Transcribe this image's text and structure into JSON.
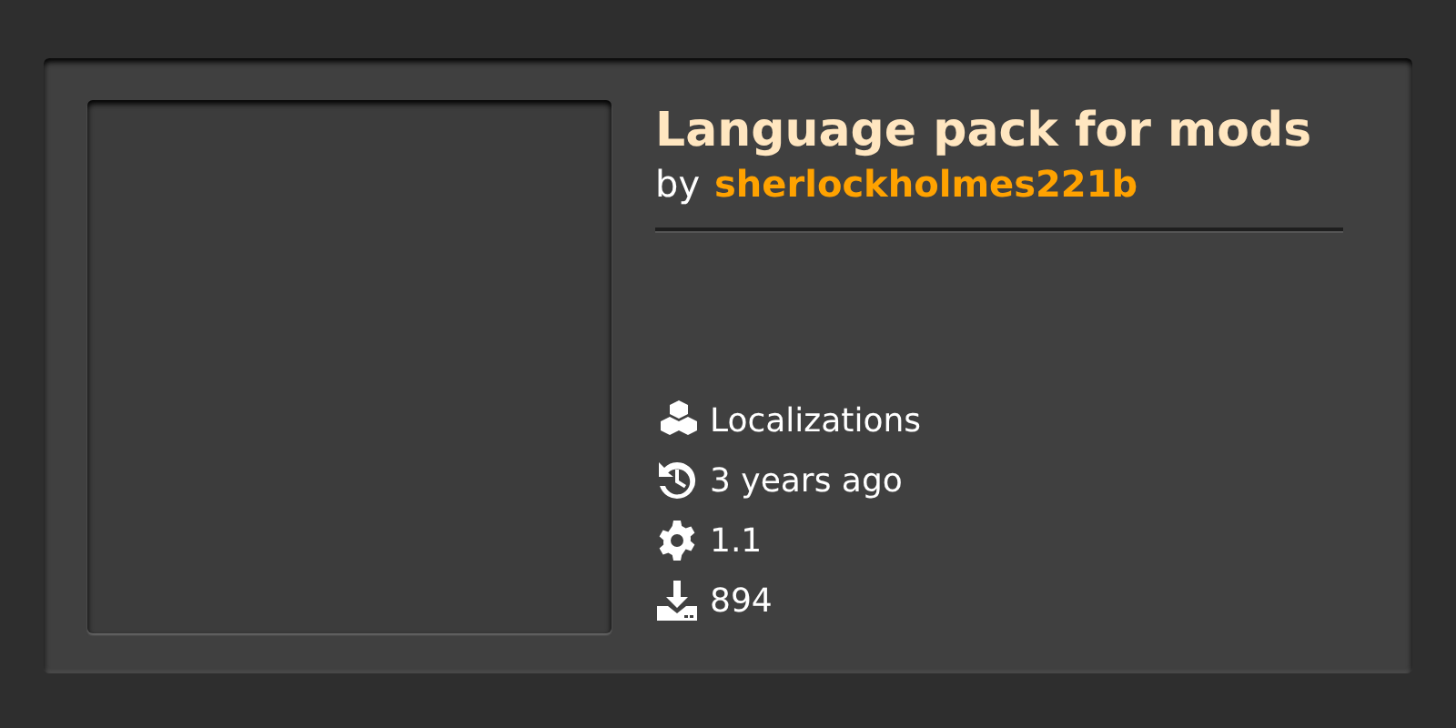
{
  "mod": {
    "title": "Language pack for mods",
    "byline": "by",
    "author": "sherlockholmes221b",
    "details": [
      {
        "kind": "category",
        "text": "Localizations"
      },
      {
        "kind": "updated",
        "text": "3 years ago"
      },
      {
        "kind": "version",
        "text": "1.1"
      },
      {
        "kind": "downloads",
        "text": "894"
      }
    ]
  }
}
